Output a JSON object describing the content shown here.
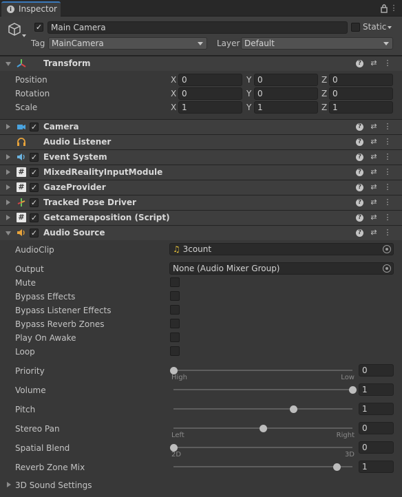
{
  "tab": {
    "label": "Inspector",
    "icon": "info-icon"
  },
  "gameobject": {
    "active": true,
    "name": "Main Camera",
    "static_label": "Static",
    "static": false,
    "tag_label": "Tag",
    "tag_value": "MainCamera",
    "layer_label": "Layer",
    "layer_value": "Default"
  },
  "transform": {
    "title": "Transform",
    "rows": [
      {
        "label": "Position",
        "x": "0",
        "y": "0",
        "z": "0"
      },
      {
        "label": "Rotation",
        "x": "0",
        "y": "0",
        "z": "0"
      },
      {
        "label": "Scale",
        "x": "1",
        "y": "1",
        "z": "1"
      }
    ],
    "axis_x": "X",
    "axis_y": "Y",
    "axis_z": "Z"
  },
  "components": [
    {
      "title": "Camera",
      "icon": "camera-icon",
      "color": "#4aa3df",
      "enabled": true
    },
    {
      "title": "Audio Listener",
      "icon": "headphones-icon",
      "color": "#e8a33a",
      "enabled": null
    },
    {
      "title": "Event System",
      "icon": "event-system-icon",
      "color": "#6bb3e0",
      "enabled": true
    },
    {
      "title": "MixedRealityInputModule",
      "icon": "script-icon",
      "color": "#e8e8e8",
      "enabled": true
    },
    {
      "title": "GazeProvider",
      "icon": "script-icon",
      "color": "#e8e8e8",
      "enabled": true
    },
    {
      "title": "Tracked Pose Driver",
      "icon": "tracked-pose-icon",
      "color": "#d64545",
      "enabled": true
    },
    {
      "title": "Getcameraposition (Script)",
      "icon": "script-icon",
      "color": "#e8e8e8",
      "enabled": true
    }
  ],
  "audio_source": {
    "title": "Audio Source",
    "enabled": true,
    "audioclip_label": "AudioClip",
    "audioclip_value": "3count",
    "output_label": "Output",
    "output_value": "None (Audio Mixer Group)",
    "toggles": [
      {
        "label": "Mute",
        "checked": false
      },
      {
        "label": "Bypass Effects",
        "checked": false
      },
      {
        "label": "Bypass Listener Effects",
        "checked": false
      },
      {
        "label": "Bypass Reverb Zones",
        "checked": false
      },
      {
        "label": "Play On Awake",
        "checked": false
      },
      {
        "label": "Loop",
        "checked": false
      }
    ],
    "sliders": [
      {
        "label": "Priority",
        "value": "0",
        "fraction": 0.0,
        "min_caption": "High",
        "max_caption": "Low"
      },
      {
        "label": "Volume",
        "value": "1",
        "fraction": 1.0,
        "min_caption": "",
        "max_caption": ""
      },
      {
        "label": "Pitch",
        "value": "1",
        "fraction": 0.67,
        "min_caption": "",
        "max_caption": ""
      },
      {
        "label": "Stereo Pan",
        "value": "0",
        "fraction": 0.5,
        "min_caption": "Left",
        "max_caption": "Right"
      },
      {
        "label": "Spatial Blend",
        "value": "0",
        "fraction": 0.0,
        "min_caption": "2D",
        "max_caption": "3D"
      },
      {
        "label": "Reverb Zone Mix",
        "value": "1",
        "fraction": 0.91,
        "min_caption": "",
        "max_caption": ""
      }
    ],
    "sound_settings_label": "3D Sound Settings"
  },
  "colors": {
    "accent": "#3a79bb",
    "audio_source_icon": "#e8a33a"
  }
}
